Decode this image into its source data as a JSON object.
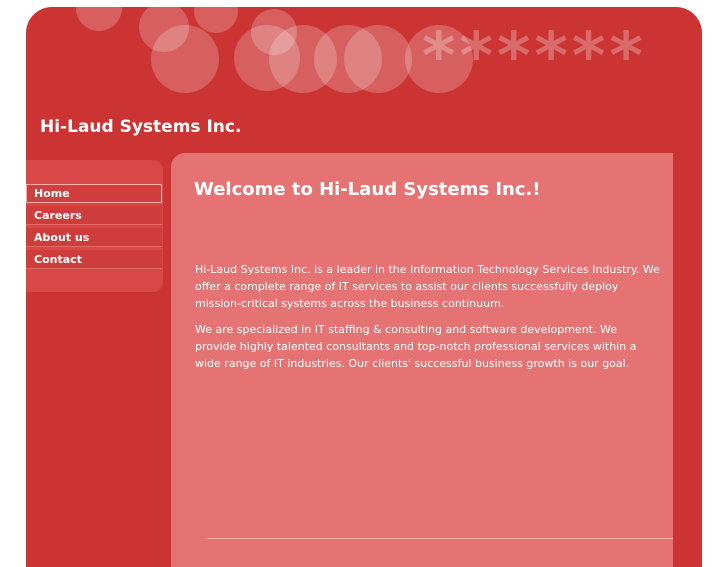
{
  "header": {
    "company_name": "Hi-Laud Systems Inc.",
    "decoration_glyphs": "******"
  },
  "nav": {
    "items": [
      {
        "label": "Home",
        "active": true
      },
      {
        "label": "Careers",
        "active": false
      },
      {
        "label": "About us",
        "active": false
      },
      {
        "label": "Contact",
        "active": false
      }
    ]
  },
  "main": {
    "title": "Welcome to Hi-Laud Systems Inc.!",
    "paragraphs": [
      "Hi-Laud Systems Inc. is a leader in the Information Technology Services Industry. We offer a complete range of IT services to assist our clients successfully deploy mission-critical systems across the business continuum.",
      "We are specialized in IT staffing & consulting and software development. We provide highly talented consultants and top-notch professional services within a wide range of IT industries. Our clients' successful business growth is our goal."
    ]
  },
  "colors": {
    "brand_red": "#cc3333",
    "content_panel": "#e57373",
    "text": "#ffffff"
  }
}
